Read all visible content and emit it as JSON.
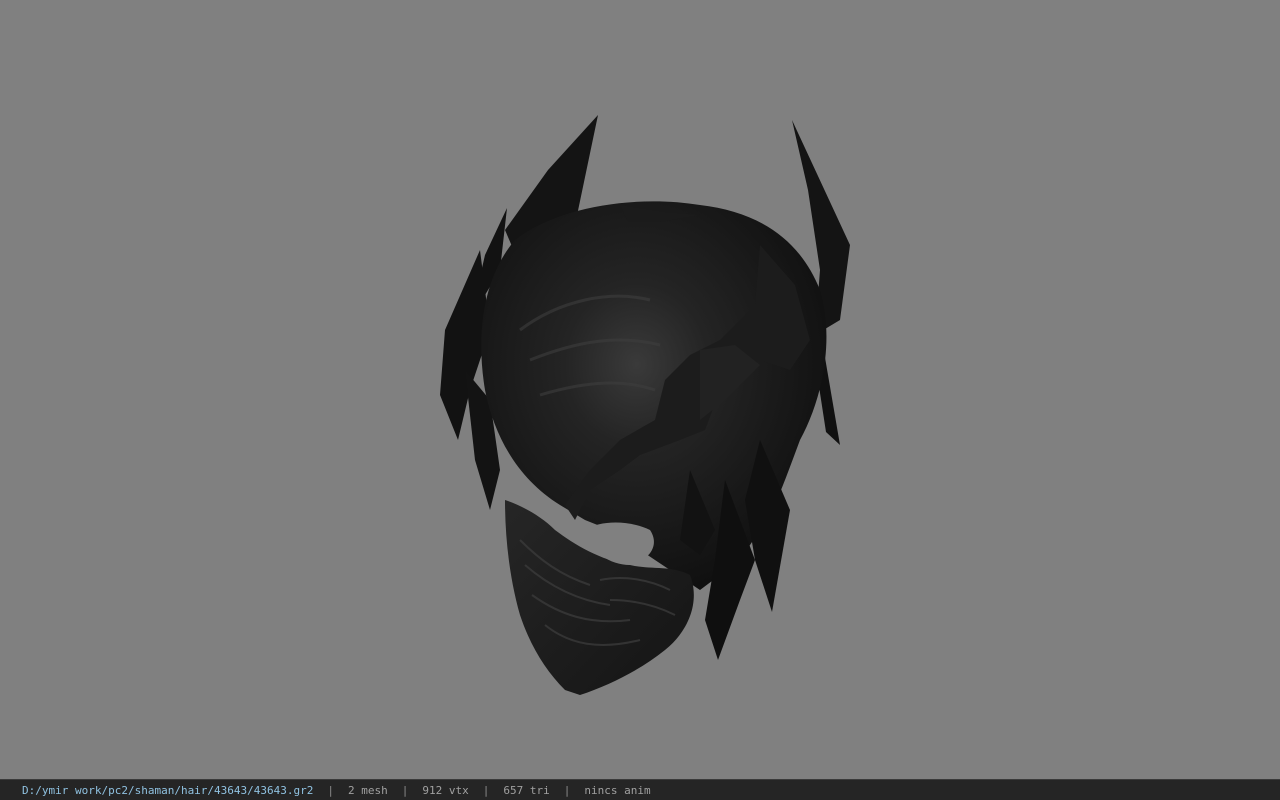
{
  "viewport": {
    "background": "#808080",
    "model_color": "#161616"
  },
  "status_bar": {
    "path": "D:/ymir work/pc2/shaman/hair/43643/43643.gr2",
    "separator": "|",
    "mesh": "2 mesh",
    "vertices": "912 vtx",
    "triangles": "657 tri",
    "animation": "nincs anim",
    "path_color": "#8fc1e0"
  }
}
